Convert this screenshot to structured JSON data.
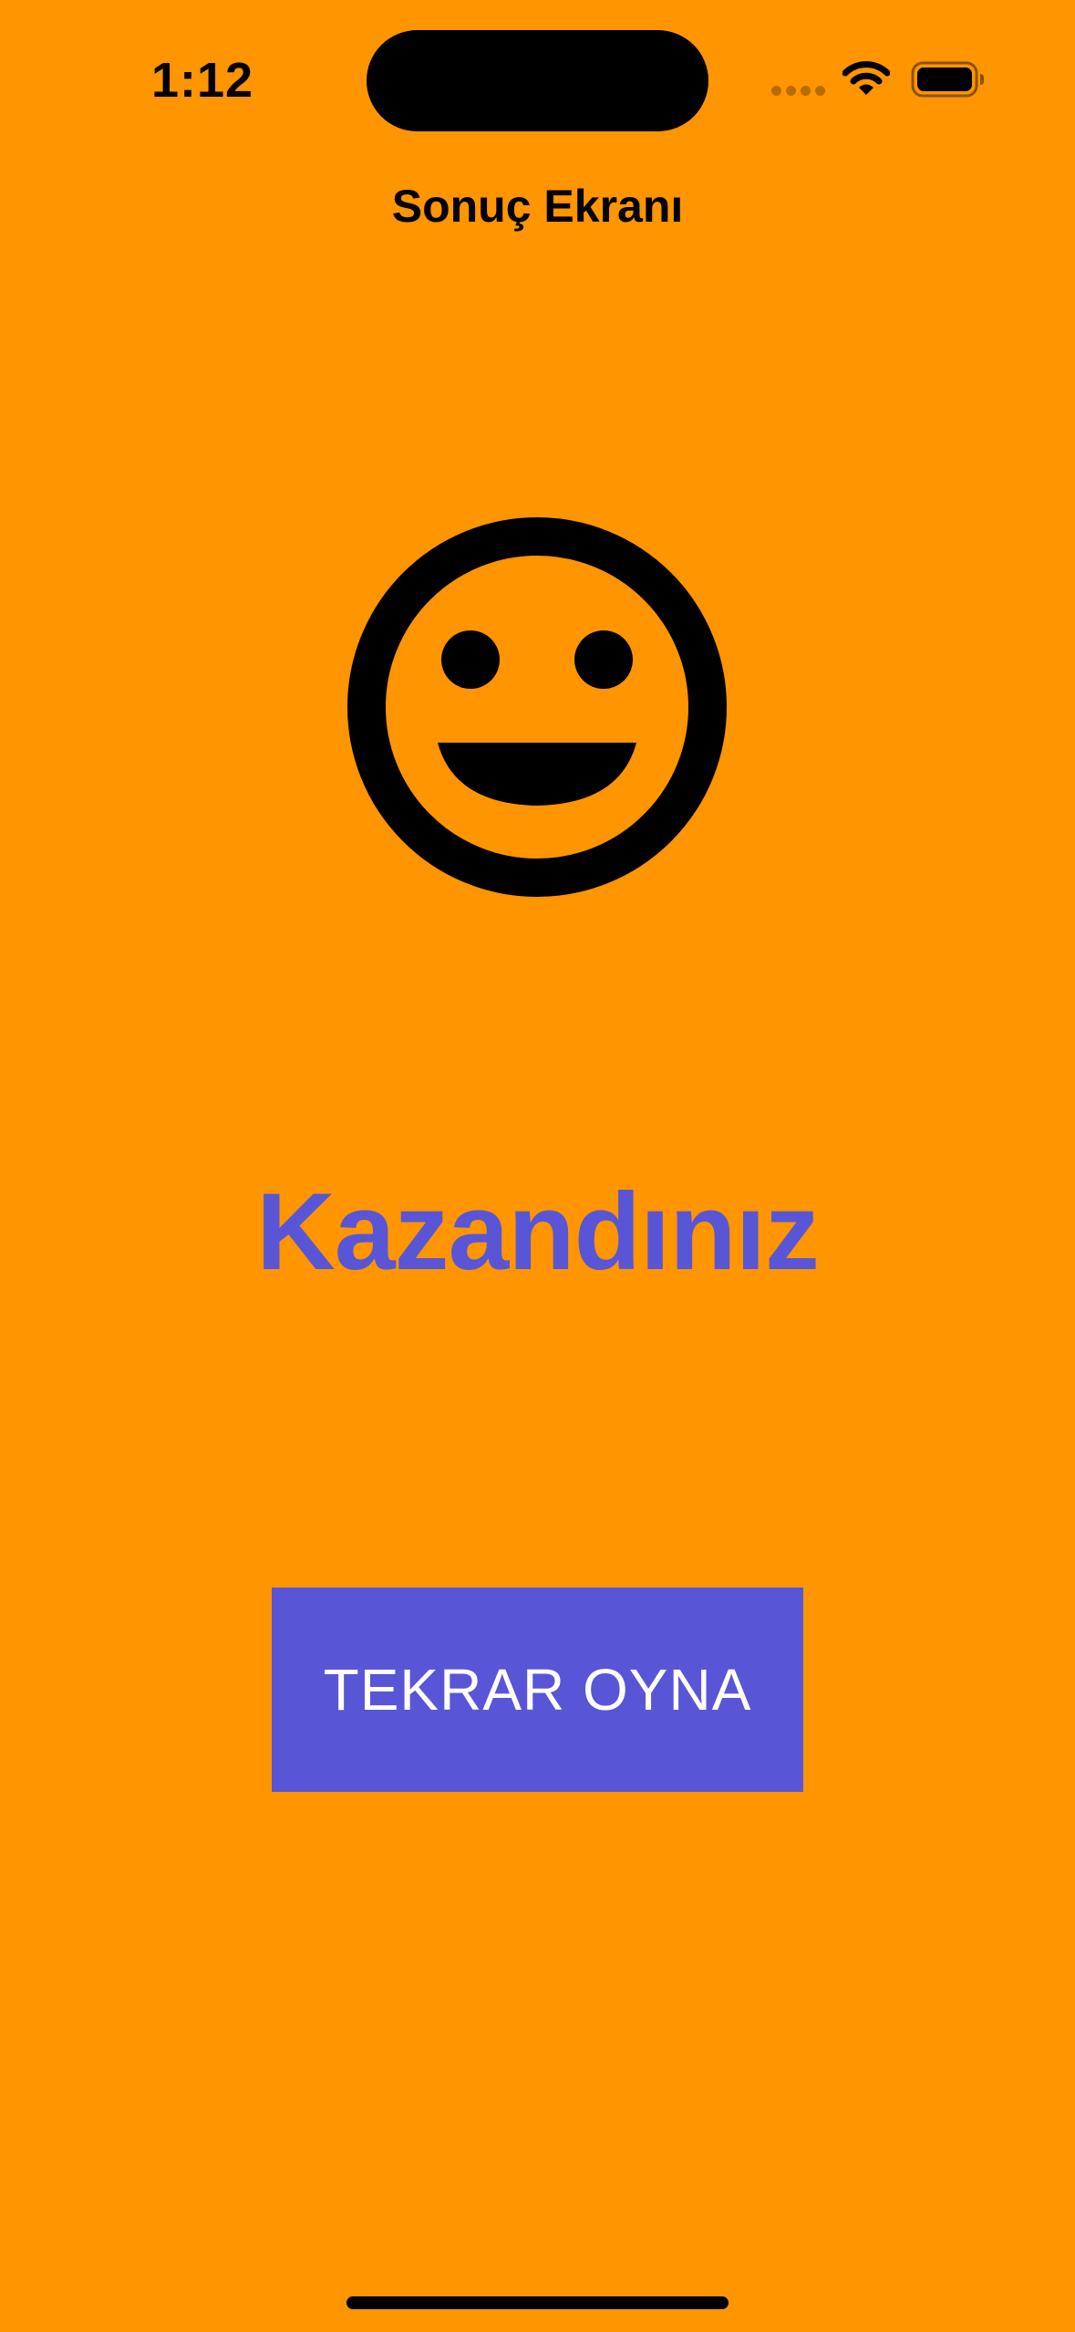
{
  "status_bar": {
    "time": "1:12",
    "wifi_icon": "wifi-icon",
    "battery_icon": "battery-icon",
    "signal_icon": "cellular-dots-icon"
  },
  "nav": {
    "title": "Sonuç Ekranı"
  },
  "result": {
    "icon": "smiley-face-icon",
    "text": "Kazandınız"
  },
  "actions": {
    "play_again_label": "TEKRAR OYNA"
  },
  "colors": {
    "background": "#FF9500",
    "accent": "#5856D6",
    "button_text": "#FFFFFF",
    "foreground": "#000000"
  }
}
